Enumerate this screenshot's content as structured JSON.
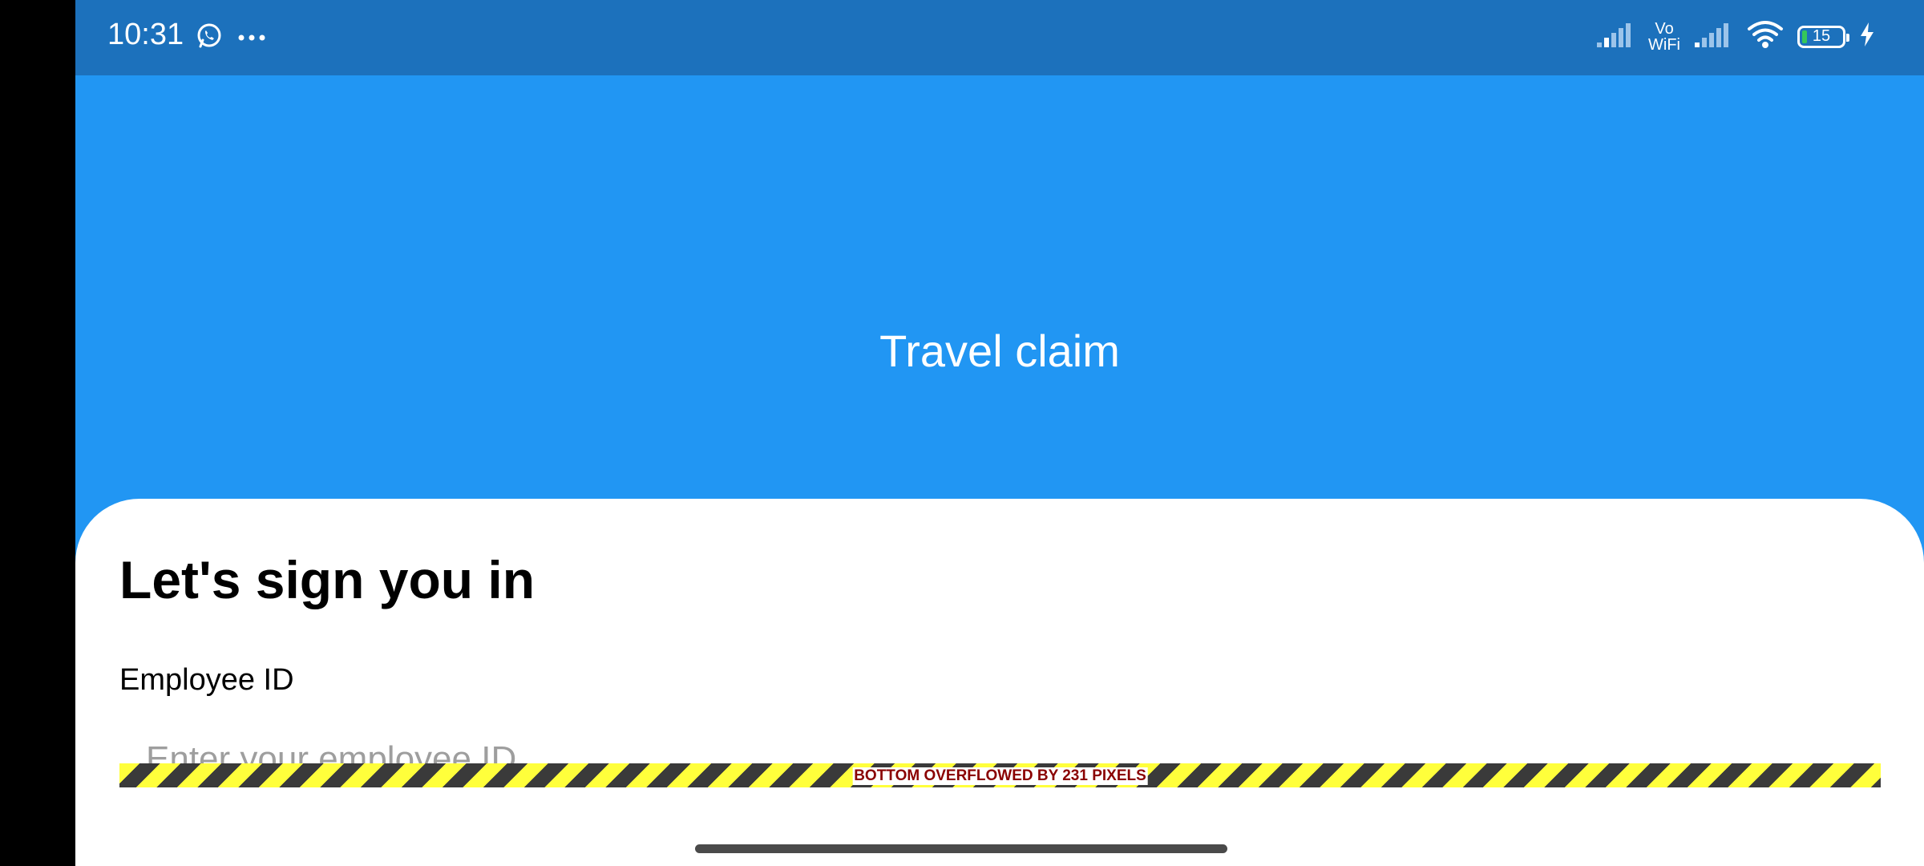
{
  "status_bar": {
    "time": "10:31",
    "left_icons": [
      "whatsapp-icon",
      "more-dots-icon"
    ],
    "vowifi_top": "Vo",
    "vowifi_bottom": "WiFi",
    "battery_level": "15",
    "right_icons": [
      "signal-icon",
      "vowifi-icon",
      "signal-icon",
      "wifi-icon",
      "battery-icon",
      "charging-icon"
    ]
  },
  "app": {
    "title": "Travel claim"
  },
  "sign_in": {
    "heading": "Let's sign you in",
    "employee_id_label": "Employee ID",
    "employee_id_placeholder": "Enter your employee ID"
  },
  "debug": {
    "overflow_message": "BOTTOM OVERFLOWED BY 231 PIXELS"
  },
  "colors": {
    "app_bar": "#2196f3",
    "status_bar": "#1c71bc",
    "card": "#ffffff",
    "overflow_text": "#8a0000"
  }
}
